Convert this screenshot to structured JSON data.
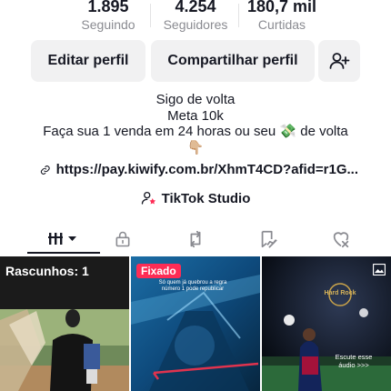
{
  "stats": [
    {
      "value": "1.895",
      "label": "Seguindo"
    },
    {
      "value": "4.254",
      "label": "Seguidores"
    },
    {
      "value": "180,7 mil",
      "label": "Curtidas"
    }
  ],
  "buttons": {
    "edit_label": "Editar perfil",
    "share_label": "Compartilhar perfil",
    "add_friend_icon": "add-user-icon"
  },
  "bio": {
    "line1": "Sigo de volta",
    "line2": "Meta 10k",
    "line3_pre": "Faça sua 1 venda em 24 horas ou seu",
    "line3_emoji": "💸",
    "line3_post": "de volta",
    "line4_emoji": "👇🏼"
  },
  "link": {
    "url": "https://pay.kiwify.com.br/XhmT4CD?afid=r1G...",
    "icon": "link-icon"
  },
  "studio": {
    "label": "TikTok Studio",
    "icon": "person-star-icon"
  },
  "tabs": [
    {
      "icon": "videos-grid-icon",
      "active": true
    },
    {
      "icon": "lock-icon",
      "active": false
    },
    {
      "icon": "repost-icon",
      "active": false
    },
    {
      "icon": "saved-icon",
      "active": false
    },
    {
      "icon": "liked-icon",
      "active": false
    }
  ],
  "grid": {
    "drafts_label": "Rascunhos: 1",
    "pinned_label": "Fixado",
    "pinned_caption": "Só quem já quebrou a regra número 1 pode republicar",
    "audio_label": "Escute esse áudio >>>",
    "brand_text": "Hard Rock",
    "accent": "#fe2c55"
  }
}
